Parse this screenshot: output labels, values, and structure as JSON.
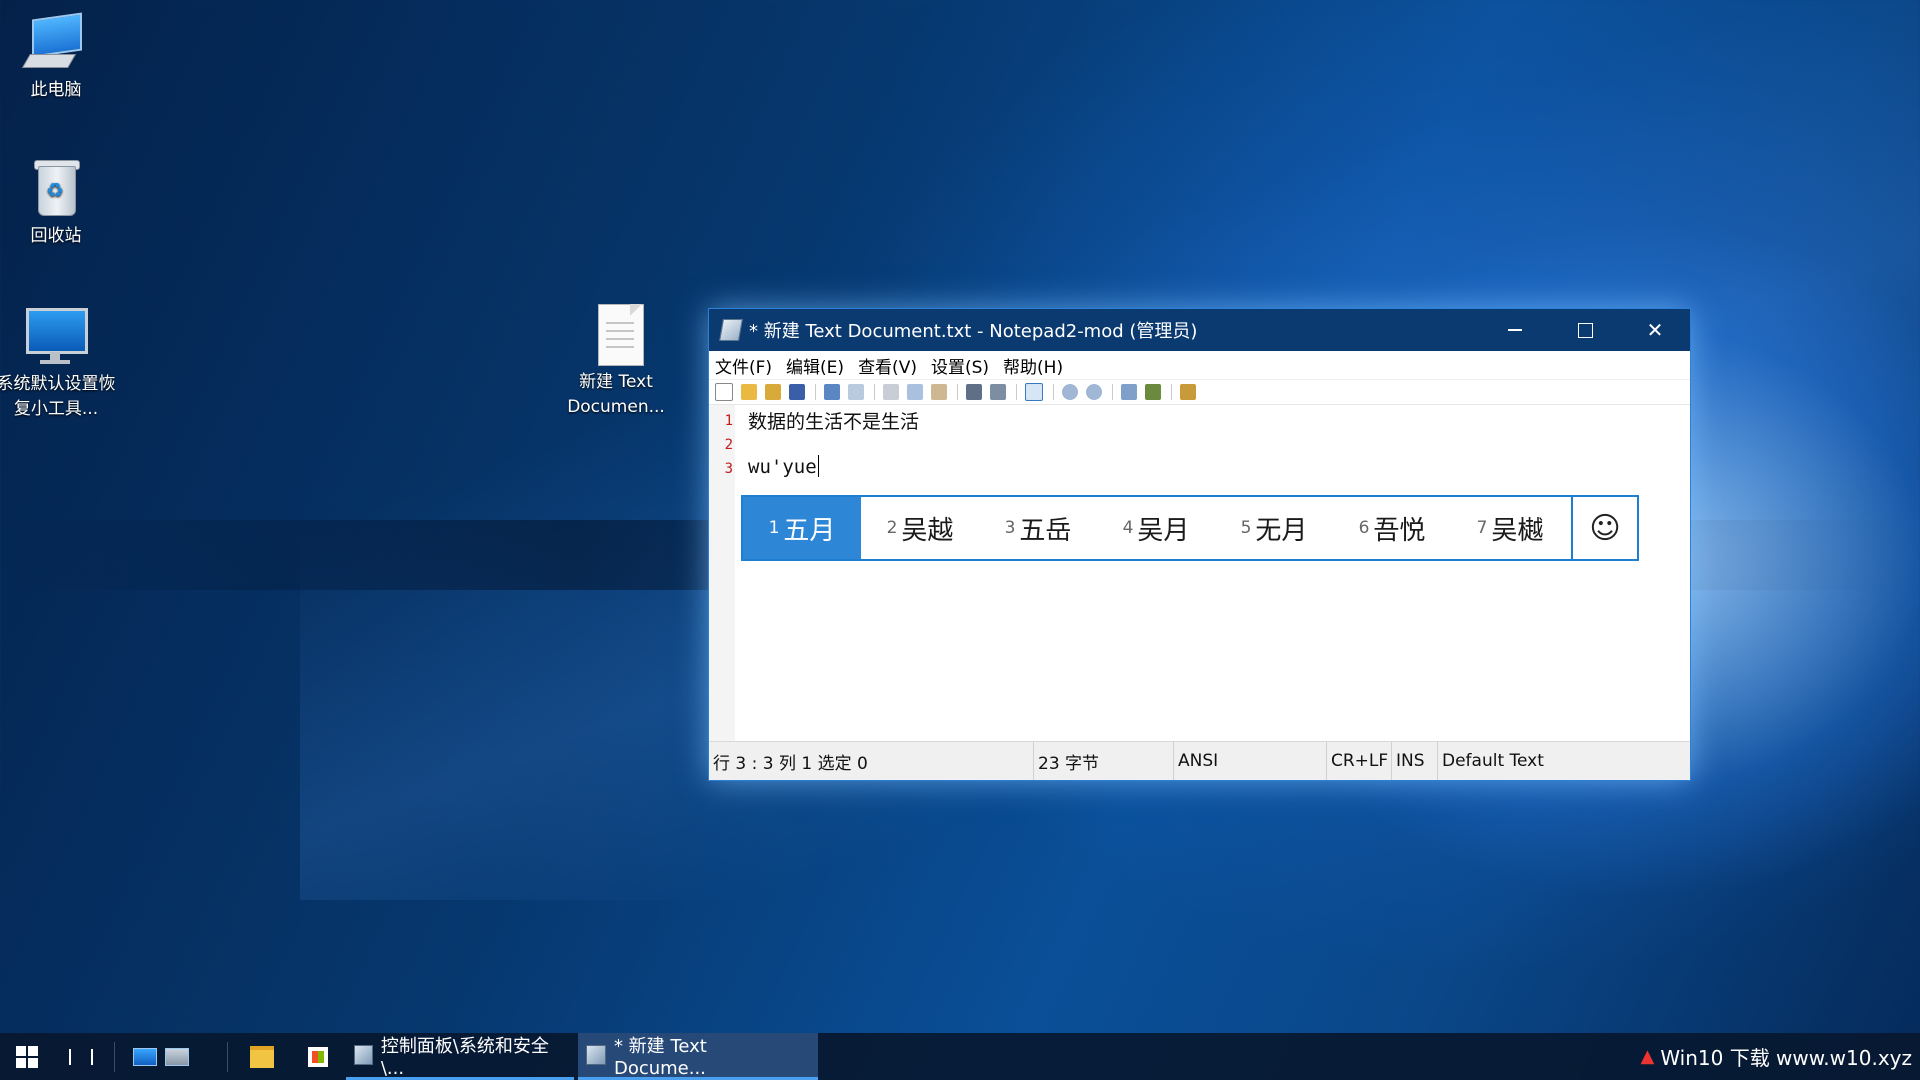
{
  "desktop": {
    "icons": [
      {
        "label": "此电脑"
      },
      {
        "label": "回收站"
      },
      {
        "label": "系统默认设置恢复小工具..."
      },
      {
        "label": "新建 Text Documen..."
      }
    ]
  },
  "window": {
    "title": "* 新建 Text Document.txt - Notepad2-mod (管理员)",
    "buttons": {
      "minimize": "minimize-icon",
      "maximize": "maximize-icon",
      "close": "✕"
    }
  },
  "menu": {
    "items": [
      "文件(F)",
      "编辑(E)",
      "查看(V)",
      "设置(S)",
      "帮助(H)"
    ]
  },
  "editor": {
    "lines": [
      {
        "number": "1",
        "text": "数据的生活不是生活"
      },
      {
        "number": "2",
        "text": ""
      },
      {
        "number": "3",
        "text": "wu'yue"
      }
    ]
  },
  "ime": {
    "candidates": [
      {
        "n": "1",
        "text": "五月"
      },
      {
        "n": "2",
        "text": "吴越"
      },
      {
        "n": "3",
        "text": "五岳"
      },
      {
        "n": "4",
        "text": "吴月"
      },
      {
        "n": "5",
        "text": "无月"
      },
      {
        "n": "6",
        "text": "吾悦"
      },
      {
        "n": "7",
        "text": "吴樾"
      }
    ],
    "emoji": "☺",
    "selected_index": 0,
    "accent": "#2d86d6"
  },
  "status": {
    "position": "行 3 : 3   列 1   选定 0",
    "bytes": "23 字节",
    "encoding": "ANSI",
    "eol": "CR+LF",
    "ins": "INS",
    "scheme": "Default Text"
  },
  "taskbar": {
    "buttons": [
      {
        "label": "控制面板\\系统和安全\\..."
      },
      {
        "label": "* 新建 Text Docume..."
      }
    ],
    "tray": "Win10 下载 www.w10.xyz"
  }
}
